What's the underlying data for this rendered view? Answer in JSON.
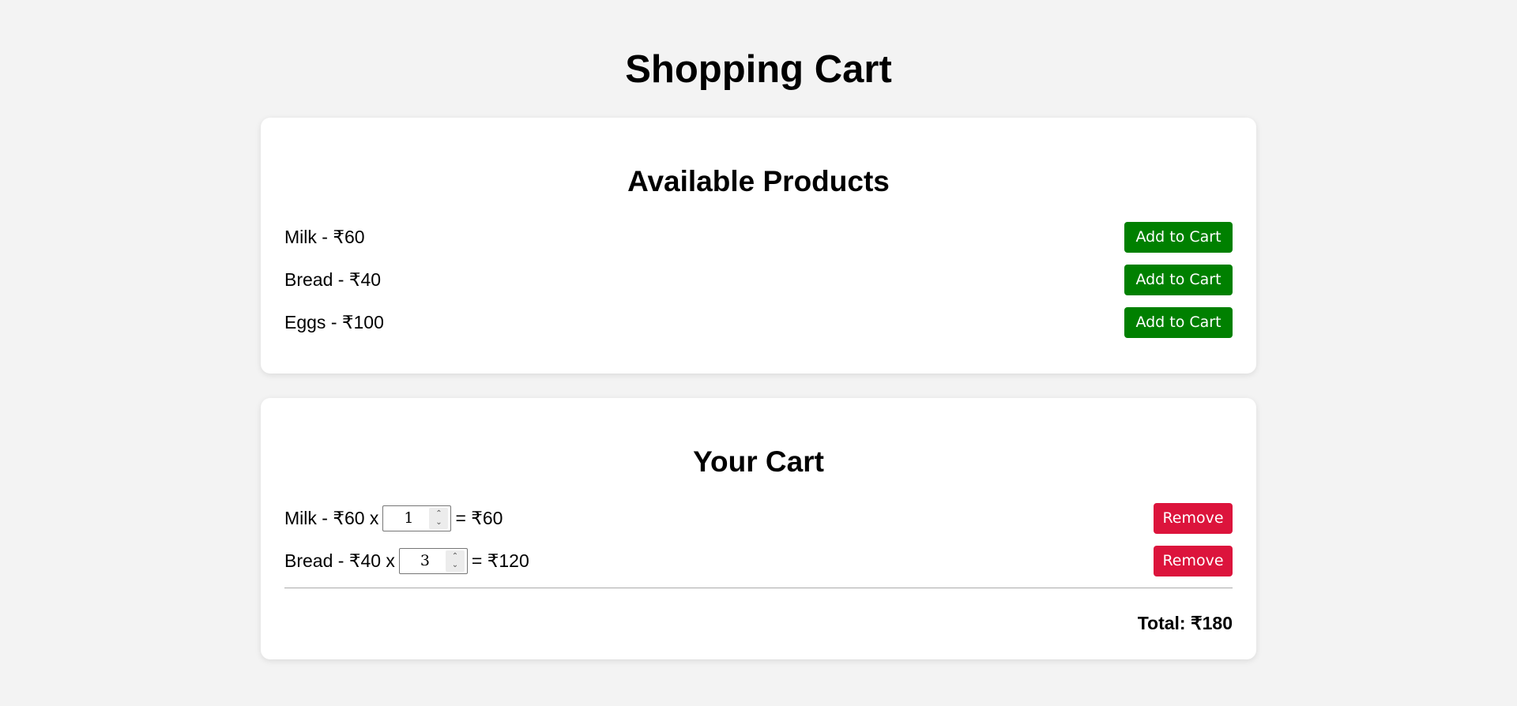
{
  "page": {
    "title": "Shopping Cart"
  },
  "products": {
    "heading": "Available Products",
    "items": [
      {
        "label": "Milk - ₹60",
        "button": "Add to Cart"
      },
      {
        "label": "Bread - ₹40",
        "button": "Add to Cart"
      },
      {
        "label": "Eggs - ₹100",
        "button": "Add to Cart"
      }
    ]
  },
  "cart": {
    "heading": "Your Cart",
    "items": [
      {
        "label": "Milk - ₹60 x",
        "quantity": "1",
        "subtotal": "= ₹60",
        "button": "Remove"
      },
      {
        "label": "Bread - ₹40 x",
        "quantity": "3",
        "subtotal": "= ₹120",
        "button": "Remove"
      }
    ],
    "total": "Total: ₹180"
  },
  "colors": {
    "add_button": "#008000",
    "remove_button": "#dc143c",
    "background": "#f3f3f3"
  }
}
